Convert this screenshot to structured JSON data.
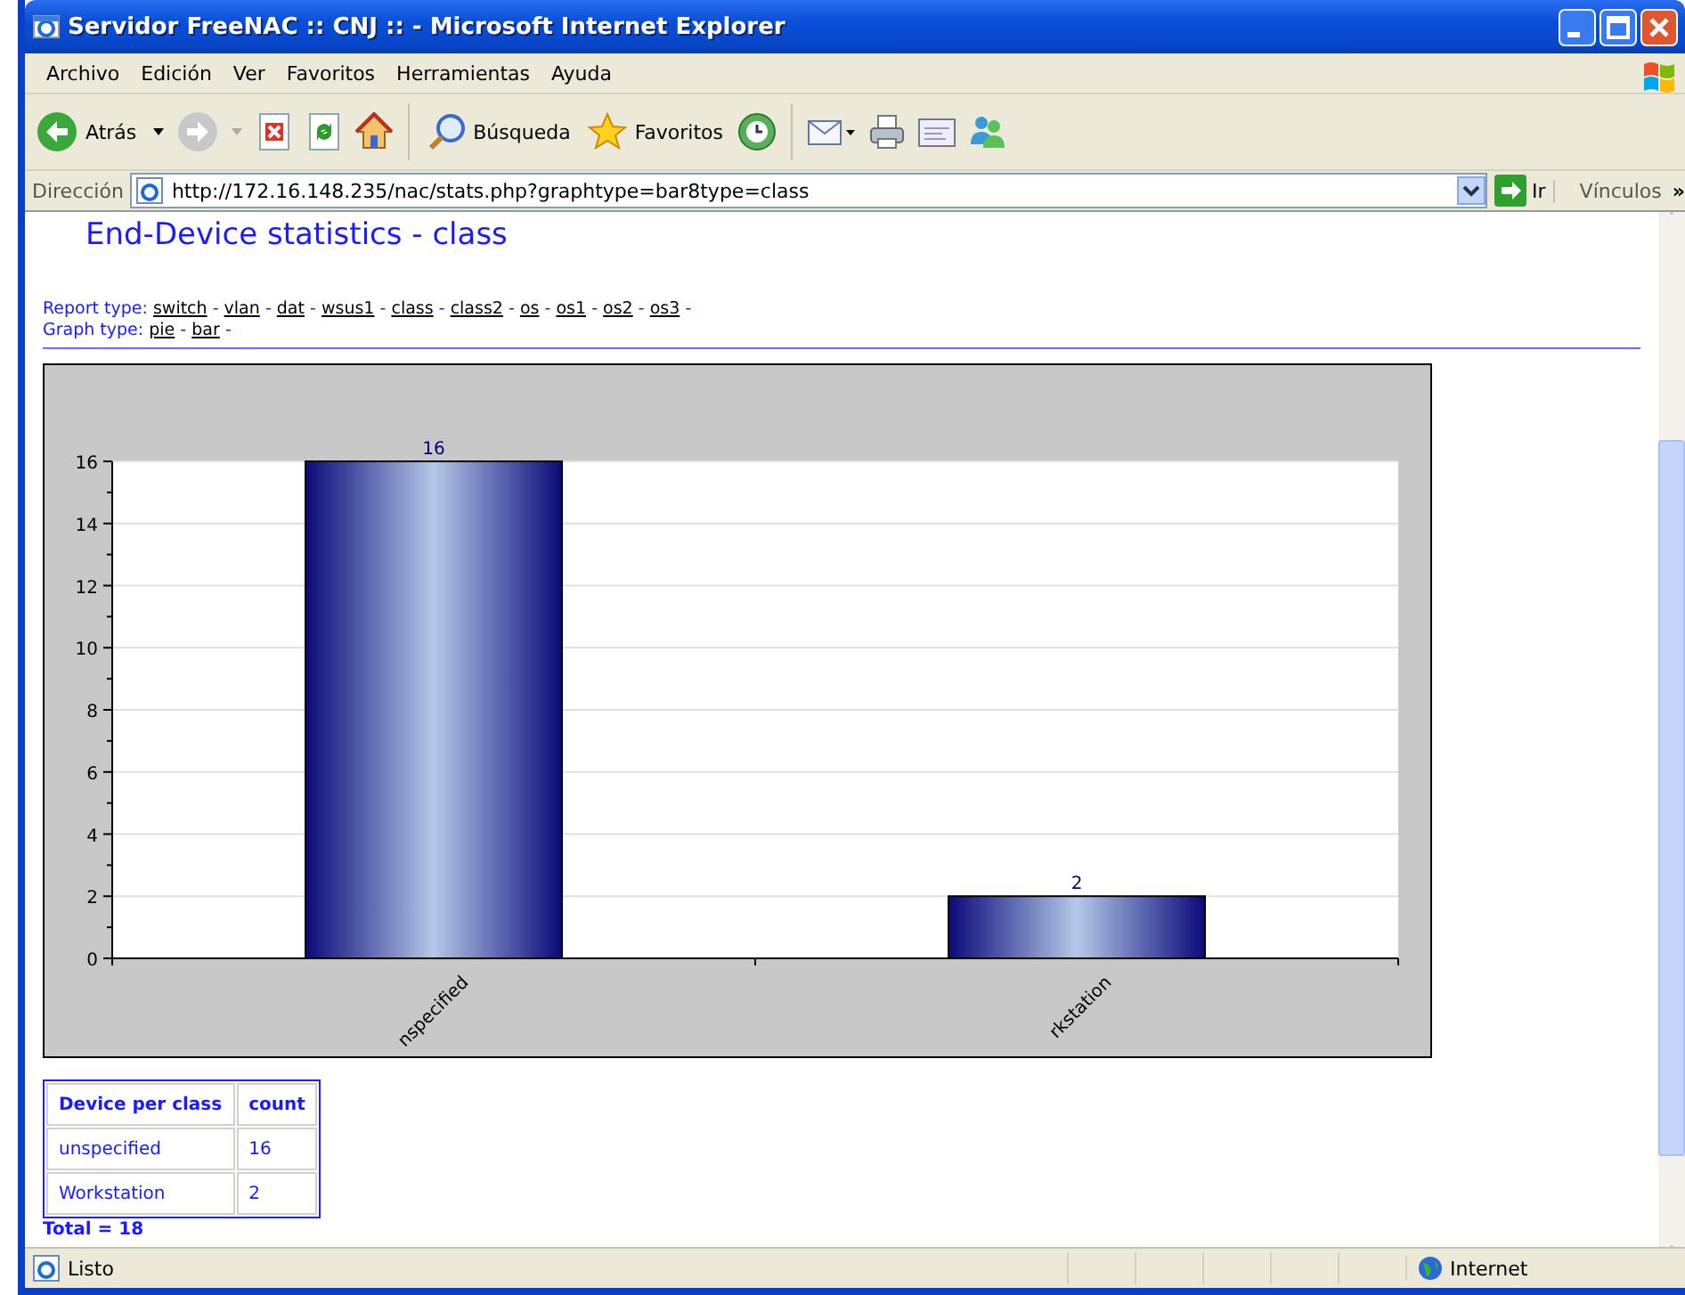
{
  "window": {
    "title": "Servidor FreeNAC :: CNJ :: - Microsoft Internet Explorer"
  },
  "menu": [
    "Archivo",
    "Edición",
    "Ver",
    "Favoritos",
    "Herramientas",
    "Ayuda"
  ],
  "toolbar": {
    "back": "Atrás",
    "search": "Búsqueda",
    "favorites": "Favoritos"
  },
  "address_bar": {
    "label": "Dirección",
    "url": "http://172.16.148.235/nac/stats.php?graphtype=bar8type=class",
    "go": "Ir",
    "links": "Vínculos",
    "more": "»"
  },
  "page": {
    "title": "End-Device statistics - class",
    "report_type": {
      "label": "Report type:",
      "links": [
        {
          "label": "switch",
          "after": "-"
        },
        {
          "label": "vlan",
          "after": "-"
        },
        {
          "label": "dat",
          "after": "-"
        },
        {
          "label": "wsus1",
          "after": "-"
        },
        {
          "label": "class",
          "after": "-"
        },
        {
          "label": "class2",
          "after": "-"
        },
        {
          "label": "os",
          "after": "-"
        },
        {
          "label": "os1",
          "after": "-"
        },
        {
          "label": "os2",
          "after": "-"
        },
        {
          "label": "os3",
          "after": "-"
        }
      ]
    },
    "graph_type": {
      "label": "Graph type:",
      "links": [
        {
          "label": "pie",
          "after": "-"
        },
        {
          "label": "bar",
          "after": "-"
        }
      ]
    },
    "chart_data": {
      "type": "bar",
      "categories": [
        "nspecified",
        "rkstation"
      ],
      "values": [
        16,
        2
      ],
      "ylim": [
        0,
        16
      ],
      "yticks": [
        0,
        2,
        4,
        6,
        8,
        10,
        12,
        14,
        16
      ],
      "data_labels": true,
      "grid": true
    },
    "table": {
      "columns": [
        "Device per class",
        "count"
      ],
      "rows": [
        [
          "unspecified",
          "16"
        ],
        [
          "Workstation",
          "2"
        ]
      ]
    },
    "total": "Total = 18"
  },
  "status_bar": {
    "text": "Listo",
    "zone": "Internet"
  }
}
